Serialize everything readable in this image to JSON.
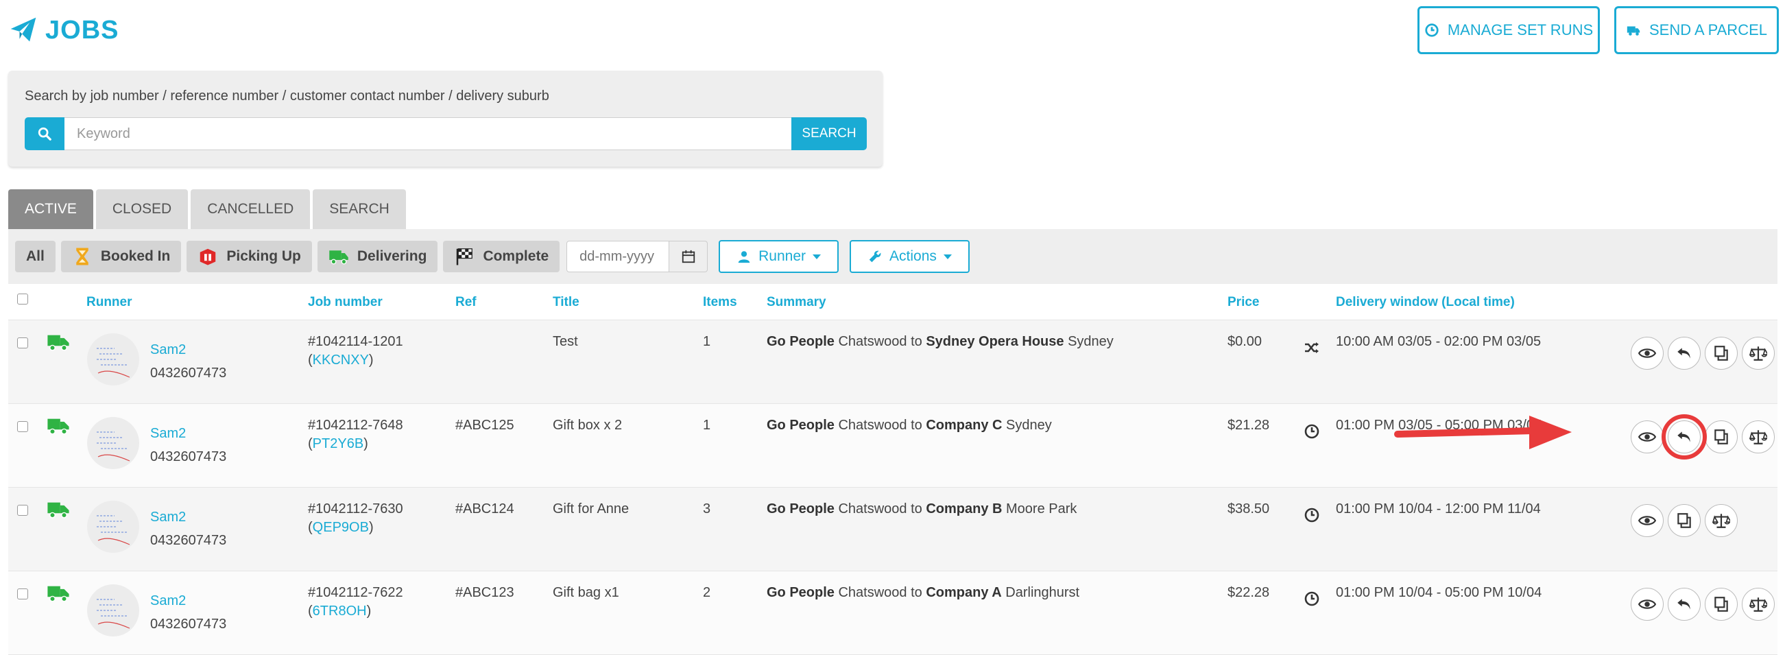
{
  "header": {
    "title": "JOBS",
    "manage_set_runs": "MANAGE SET RUNS",
    "send_parcel": "SEND A PARCEL"
  },
  "search": {
    "hint": "Search by job number / reference number / customer contact number / delivery suburb",
    "placeholder": "Keyword",
    "button": "SEARCH"
  },
  "tabs": [
    "ACTIVE",
    "CLOSED",
    "CANCELLED",
    "SEARCH"
  ],
  "filters": {
    "all": "All",
    "booked_in": "Booked In",
    "picking_up": "Picking Up",
    "delivering": "Delivering",
    "complete": "Complete",
    "date_placeholder": "dd-mm-yyyy",
    "runner": "Runner",
    "actions": "Actions"
  },
  "columns": {
    "runner": "Runner",
    "job_number": "Job number",
    "ref": "Ref",
    "title": "Title",
    "items": "Items",
    "summary": "Summary",
    "price": "Price",
    "delivery_window": "Delivery window (Local time)"
  },
  "rows": [
    {
      "runner_name": "Sam2",
      "phone": "0432607473",
      "job": "#1042114-1201",
      "code": "KKCNXY",
      "ref": "",
      "title": "Test",
      "items": "1",
      "s_company": "Go People",
      "s_from": " Chatswood to ",
      "s_dest": "Sydney Opera House",
      "s_suburb": " Sydney",
      "price": "$0.00",
      "window": "10:00 AM 03/05 - 02:00 PM 03/05",
      "status_icon": "shuffle-icon"
    },
    {
      "runner_name": "Sam2",
      "phone": "0432607473",
      "job": "#1042112-7648",
      "code": "PT2Y6B",
      "ref": "#ABC125",
      "title": "Gift box x 2",
      "items": "1",
      "s_company": "Go People",
      "s_from": " Chatswood to ",
      "s_dest": "Company C",
      "s_suburb": " Sydney",
      "price": "$21.28",
      "window": "01:00 PM 03/05 - 05:00 PM 03/05",
      "status_icon": "clock-icon"
    },
    {
      "runner_name": "Sam2",
      "phone": "0432607473",
      "job": "#1042112-7630",
      "code": "QEP9OB",
      "ref": "#ABC124",
      "title": "Gift for Anne",
      "items": "3",
      "s_company": "Go People",
      "s_from": " Chatswood to ",
      "s_dest": "Company B",
      "s_suburb": " Moore Park",
      "price": "$38.50",
      "window": "01:00 PM 10/04 - 12:00 PM 11/04",
      "status_icon": "clock-icon"
    },
    {
      "runner_name": "Sam2",
      "phone": "0432607473",
      "job": "#1042112-7622",
      "code": "6TR8OH",
      "ref": "#ABC123",
      "title": "Gift bag x1",
      "items": "2",
      "s_company": "Go People",
      "s_from": " Chatswood to ",
      "s_dest": "Company A",
      "s_suburb": " Darlinghurst",
      "price": "$22.28",
      "window": "01:00 PM 10/04 - 05:00 PM 10/04",
      "status_icon": "clock-icon"
    }
  ],
  "colors": {
    "accent": "#1aabd4",
    "highlight": "#e83b3b",
    "delivering_green": "#2fb344"
  }
}
